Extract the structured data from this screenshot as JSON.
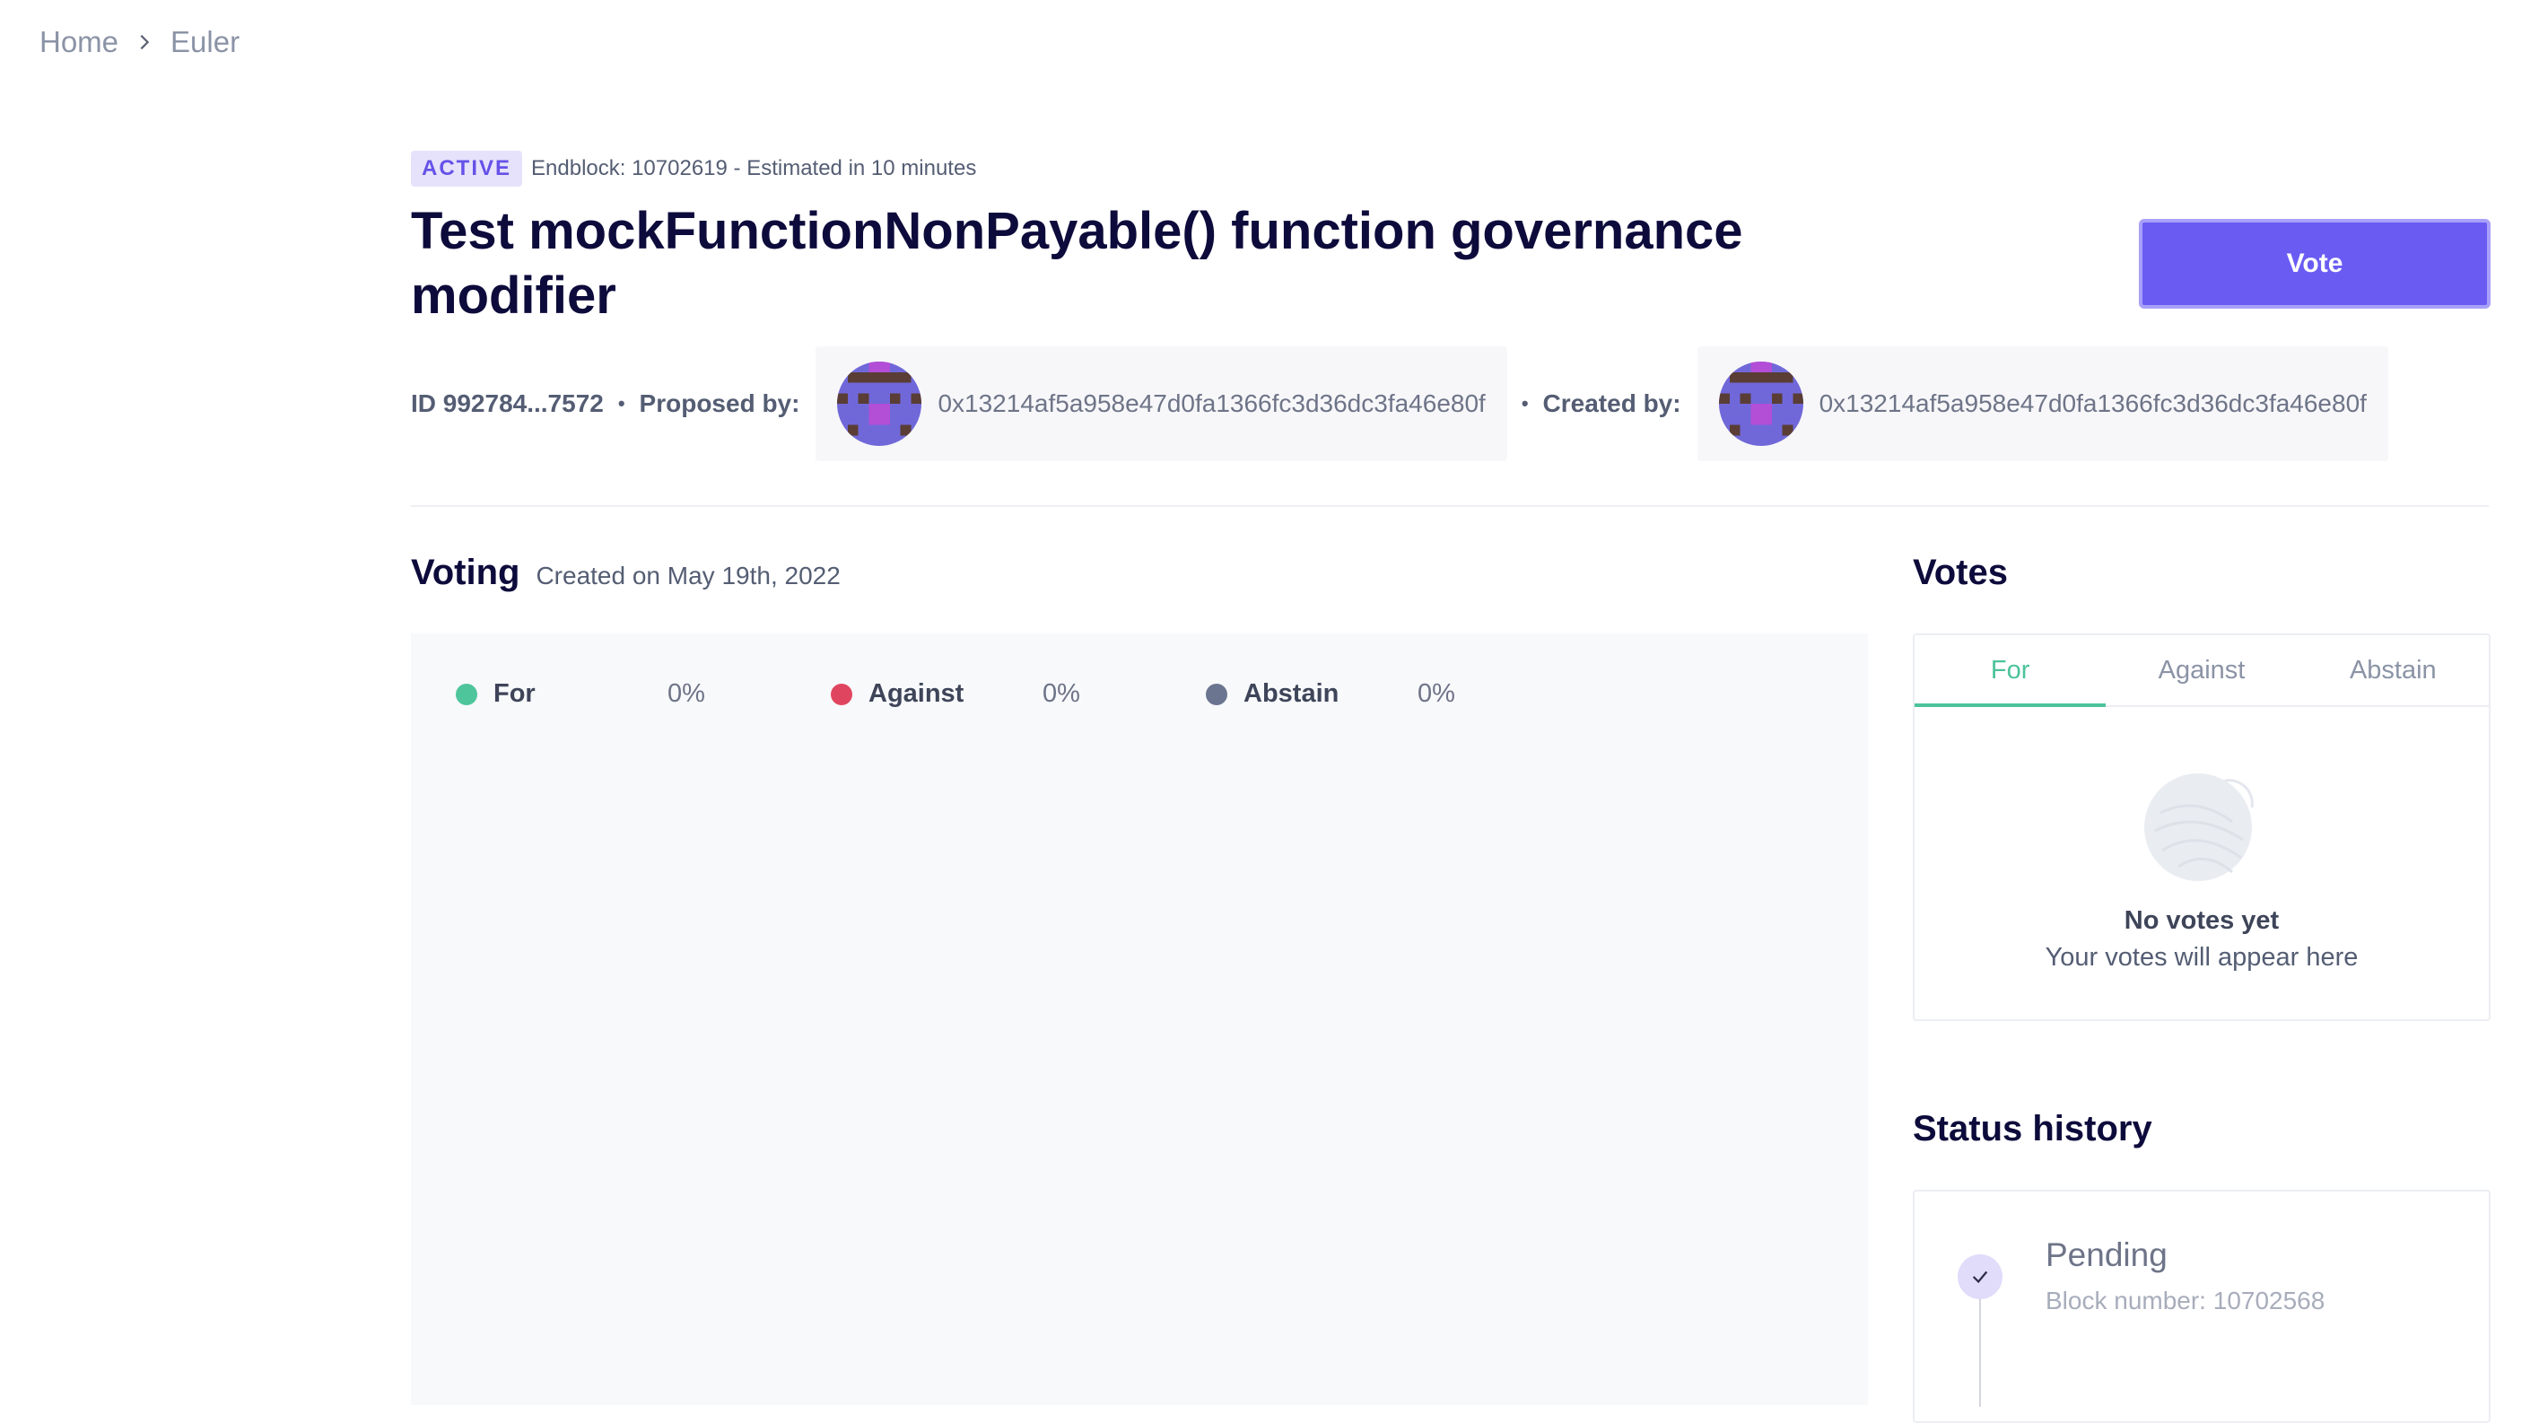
{
  "breadcrumb": {
    "home": "Home",
    "current": "Euler"
  },
  "proposal": {
    "status_badge": "ACTIVE",
    "endblock_text": "Endblock: 10702619 - Estimated in 10 minutes",
    "title": "Test mockFunctionNonPayable() function governance modifier",
    "vote_button": "Vote",
    "id_text": "ID 992784...7572",
    "proposed_by_label": "Proposed by:",
    "proposer_address": "0x13214af5a958e47d0fa1366fc3d36dc3fa46e80f",
    "created_by_label": "Created by:",
    "creator_address": "0x13214af5a958e47d0fa1366fc3d36dc3fa46e80f"
  },
  "voting": {
    "heading": "Voting",
    "created_on": "Created on May 19th, 2022",
    "legend": [
      {
        "name": "For",
        "percent": "0%",
        "color": "#4fc59c"
      },
      {
        "name": "Against",
        "percent": "0%",
        "color": "#e0455f"
      },
      {
        "name": "Abstain",
        "percent": "0%",
        "color": "#6b7590"
      }
    ]
  },
  "votes": {
    "heading": "Votes",
    "tabs": [
      "For",
      "Against",
      "Abstain"
    ],
    "active_tab": "For",
    "empty_title": "No votes yet",
    "empty_subtitle": "Your votes will appear here"
  },
  "status_history": {
    "heading": "Status history",
    "steps": [
      {
        "title": "Pending",
        "subtitle": "Block number: 10702568"
      }
    ]
  },
  "colors": {
    "accent": "#6a5cf3",
    "for": "#4fc59c",
    "against": "#e0455f",
    "abstain": "#6b7590"
  },
  "icons": {
    "breadcrumb_separator": "chevron-right-icon",
    "step": "check-icon"
  }
}
